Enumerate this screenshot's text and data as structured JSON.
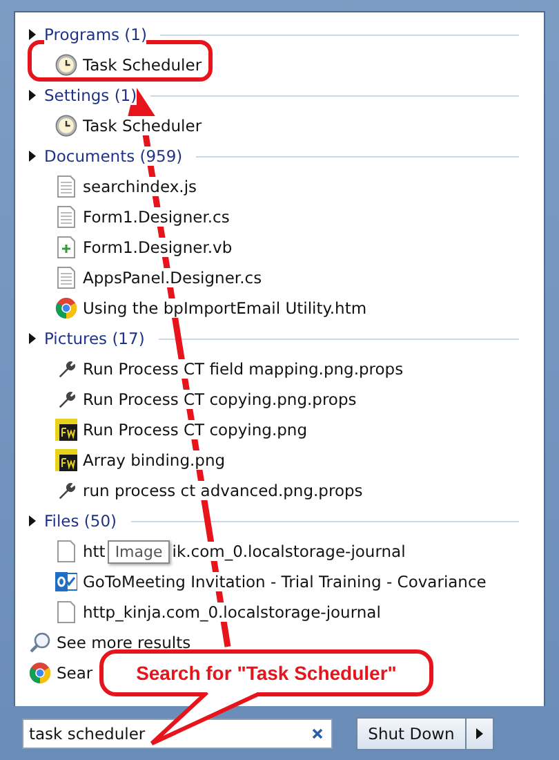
{
  "groups": [
    {
      "title": "Programs (1)",
      "items": [
        {
          "kind": "clock",
          "text": "Task Scheduler"
        }
      ]
    },
    {
      "title": "Settings (1)",
      "items": [
        {
          "kind": "clock",
          "text": "Task Scheduler"
        }
      ]
    },
    {
      "title": "Documents (959)",
      "items": [
        {
          "kind": "page",
          "text": "searchindex.js"
        },
        {
          "kind": "page",
          "text": "Form1.Designer.cs"
        },
        {
          "kind": "code",
          "text": "Form1.Designer.vb"
        },
        {
          "kind": "page",
          "text": "AppsPanel.Designer.cs"
        },
        {
          "kind": "web",
          "text": "Using the bpImportEmail Utility.htm"
        }
      ]
    },
    {
      "title": "Pictures (17)",
      "items": [
        {
          "kind": "props",
          "text": "Run Process CT field mapping.png.props"
        },
        {
          "kind": "props",
          "text": "Run Process CT copying.png.props"
        },
        {
          "kind": "image",
          "text": "Run Process CT copying.png"
        },
        {
          "kind": "image",
          "text": "Array binding.png"
        },
        {
          "kind": "props",
          "text": "run process ct advanced.png.props"
        }
      ]
    },
    {
      "title": "Files (50)",
      "items": [
        {
          "kind": "blank",
          "text": "htt",
          "tooltip": "Image",
          "text_after": "ik.com_0.localstorage-journal"
        },
        {
          "kind": "mail",
          "text": "GoToMeeting Invitation - Trial Training - Covariance"
        },
        {
          "kind": "blank",
          "text": "http_kinja.com_0.localstorage-journal"
        }
      ]
    }
  ],
  "links": [
    {
      "kind": "search",
      "text": "See more results"
    },
    {
      "kind": "web",
      "text": "Sear"
    }
  ],
  "search": {
    "value": "task scheduler"
  },
  "shutdown": {
    "label": "Shut Down"
  },
  "callout": {
    "text": "Search for \"Task Scheduler\""
  }
}
